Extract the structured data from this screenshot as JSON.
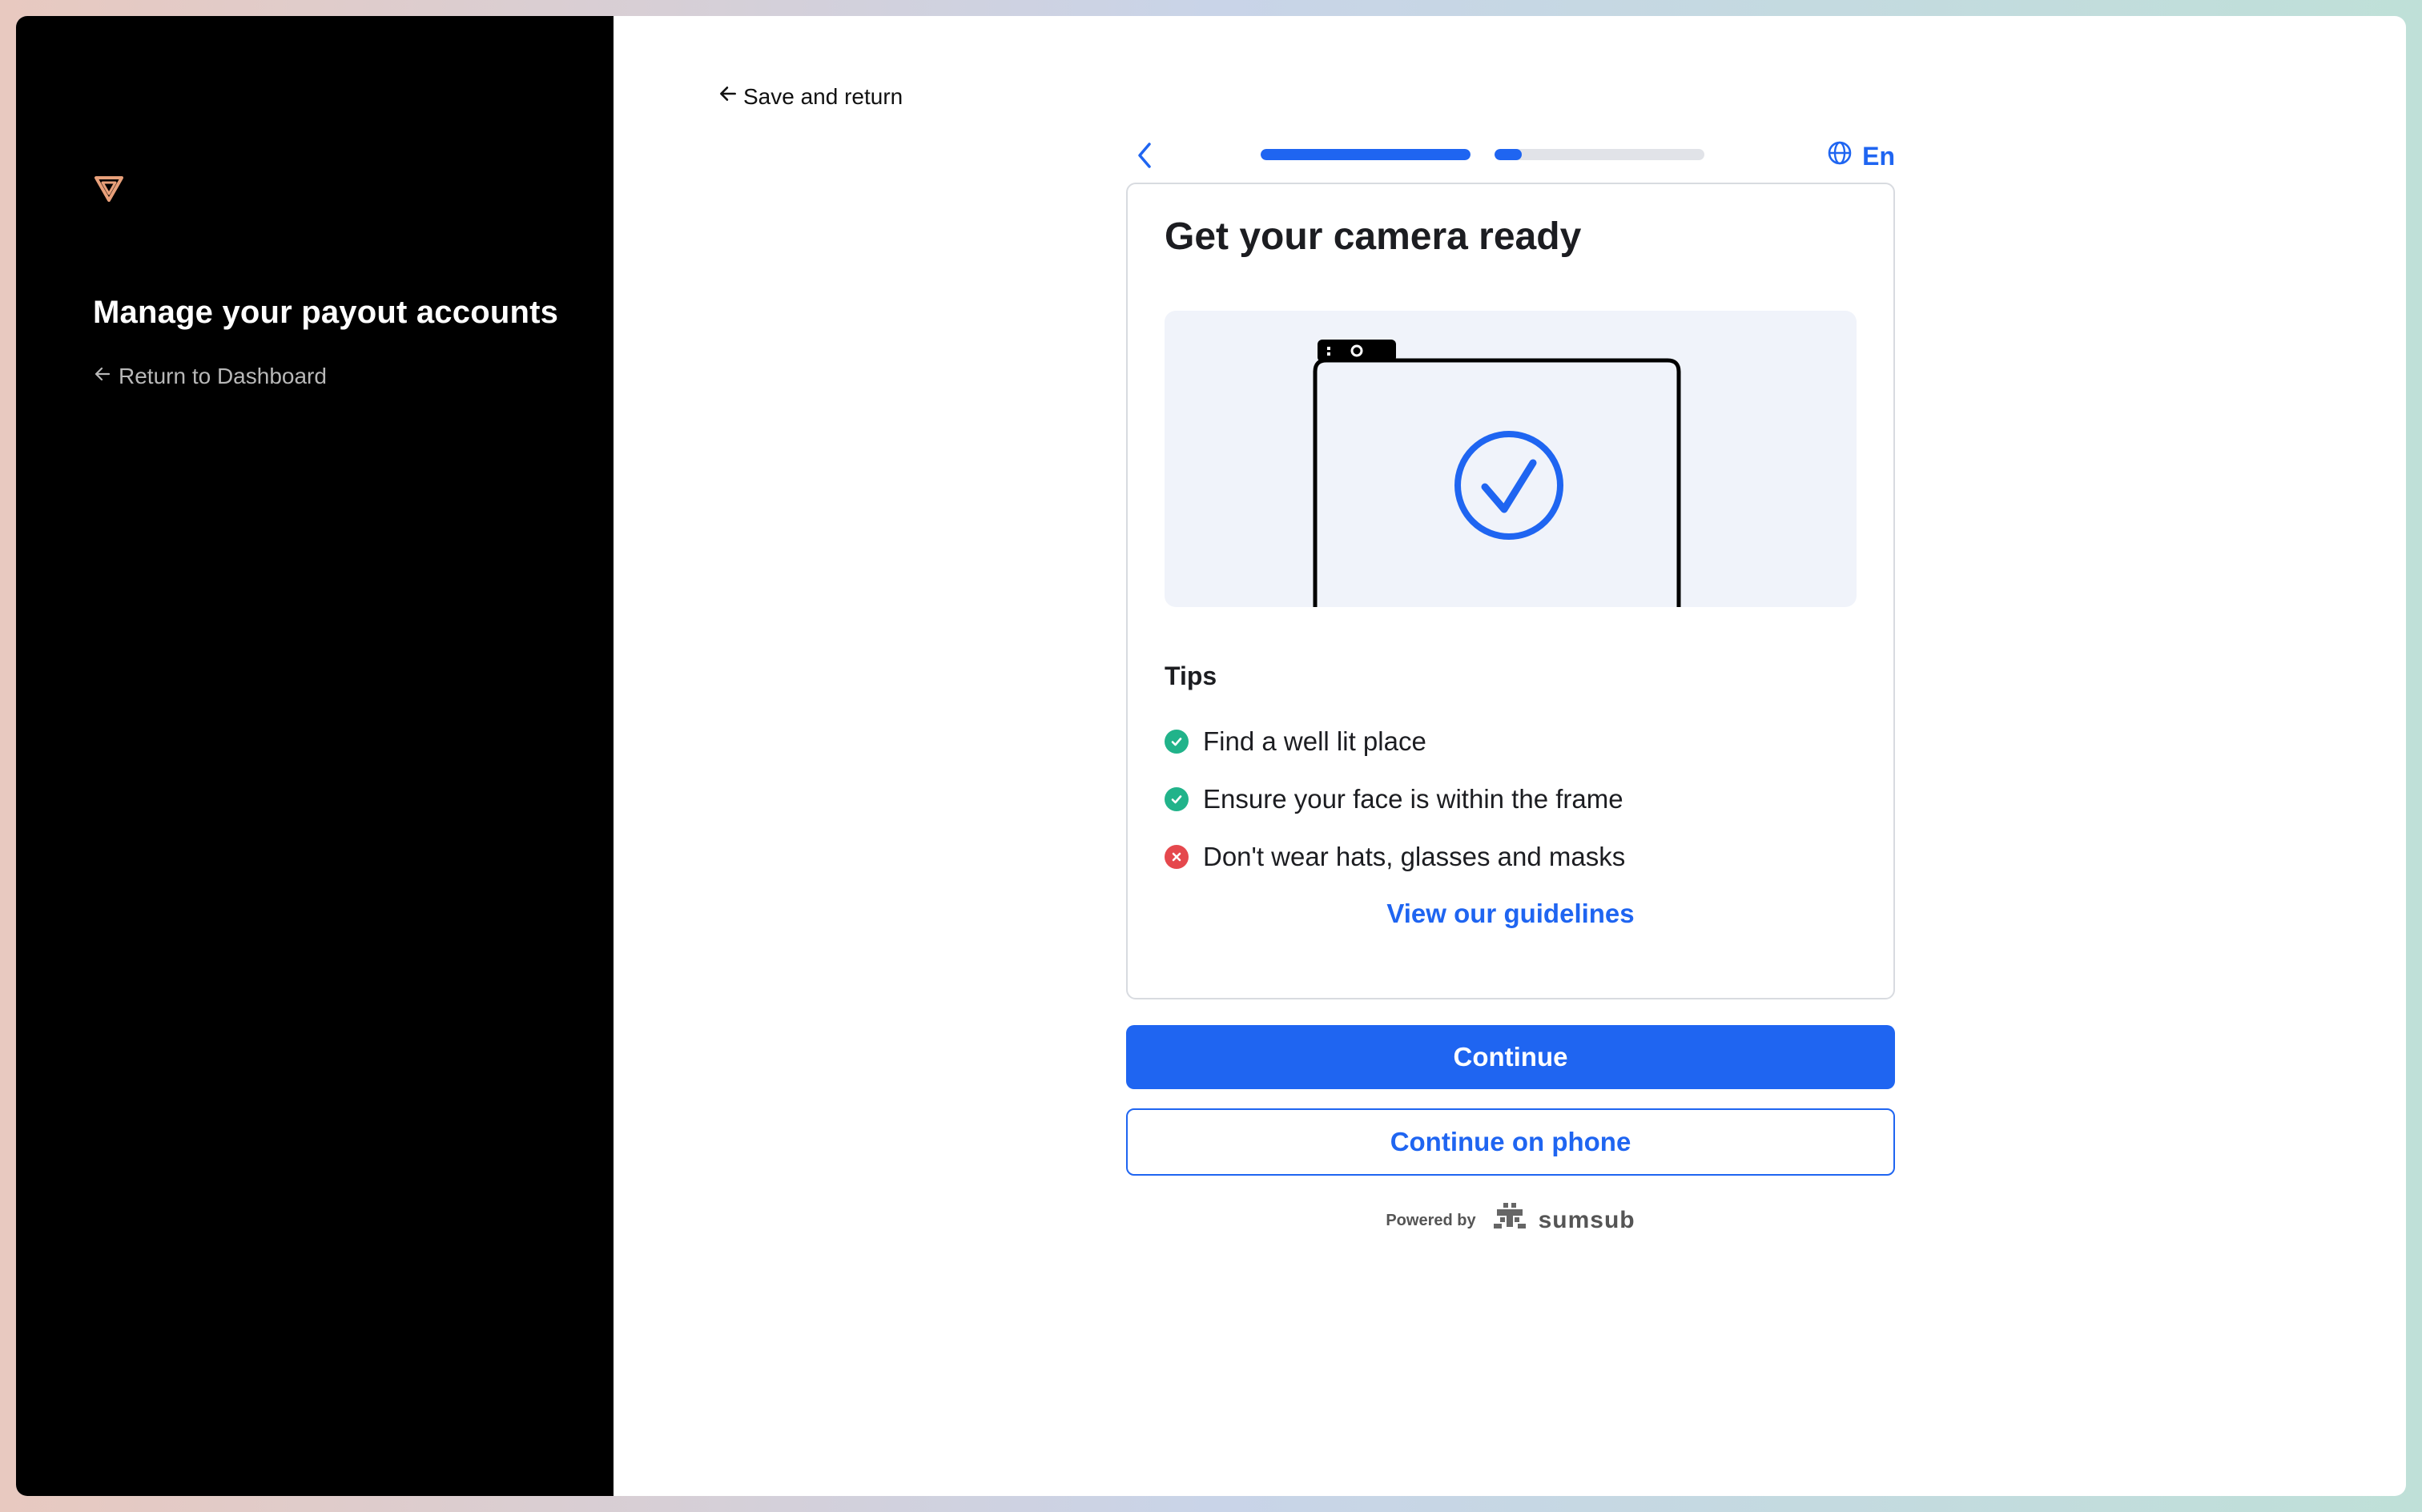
{
  "sidebar": {
    "title": "Manage your payout accounts",
    "return_link": "Return to Dashboard"
  },
  "main": {
    "save_return": "Save and return",
    "language": "En",
    "progress": [
      {
        "label": "step-1",
        "value": 1.0
      },
      {
        "label": "step-2",
        "value": 0.13
      }
    ],
    "card": {
      "title": "Get your camera ready",
      "tips_heading": "Tips",
      "tips": [
        {
          "text": "Find a well lit place",
          "status": "ok"
        },
        {
          "text": "Ensure your face is within the frame",
          "status": "ok"
        },
        {
          "text": "Don't wear hats, glasses and masks",
          "status": "bad"
        }
      ],
      "guidelines_link": "View our guidelines"
    },
    "buttons": {
      "continue": "Continue",
      "continue_phone": "Continue on phone"
    },
    "footer": {
      "powered_by": "Powered by",
      "brand": "sumsub"
    }
  },
  "colors": {
    "accent": "#1f65f1",
    "ok": "#21b38a",
    "bad": "#e5484d",
    "sidebar": "#000000",
    "logo": "#e8a07a"
  },
  "icons": {
    "logo": "triangle-logo-icon",
    "back": "chevron-left-icon",
    "globe": "globe-icon",
    "check": "check-circle-icon",
    "cross": "x-circle-icon",
    "arrow": "arrow-left-icon"
  }
}
